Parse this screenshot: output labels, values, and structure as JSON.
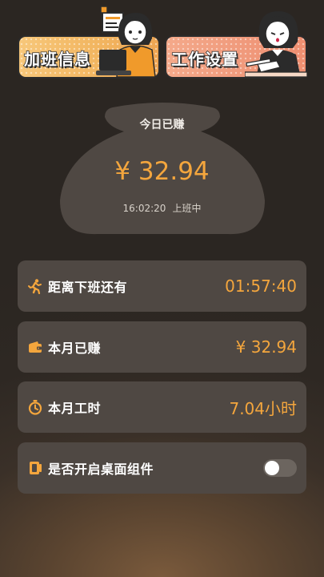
{
  "banners": {
    "overtime": {
      "label": "加班信息",
      "icon": "overtime-illustration"
    },
    "settings": {
      "label": "工作设置",
      "icon": "settings-illustration"
    }
  },
  "today": {
    "title": "今日已赚",
    "amount": "¥ 32.94",
    "time": "16:02:20",
    "status": "上班中"
  },
  "rows": [
    {
      "icon": "running-person-icon",
      "label": "距离下班还有",
      "value": "01:57:40"
    },
    {
      "icon": "wallet-icon",
      "label": "本月已赚",
      "value": "¥ 32.94"
    },
    {
      "icon": "stopwatch-icon",
      "label": "本月工时",
      "value": "7.04小时"
    },
    {
      "icon": "widget-icon",
      "label": "是否开启桌面组件",
      "toggle_on": false
    }
  ],
  "colors": {
    "accent": "#f4a63d",
    "card": "#4f4843",
    "overtime_banner": "#f2b661",
    "settings_banner": "#f09a7c"
  }
}
